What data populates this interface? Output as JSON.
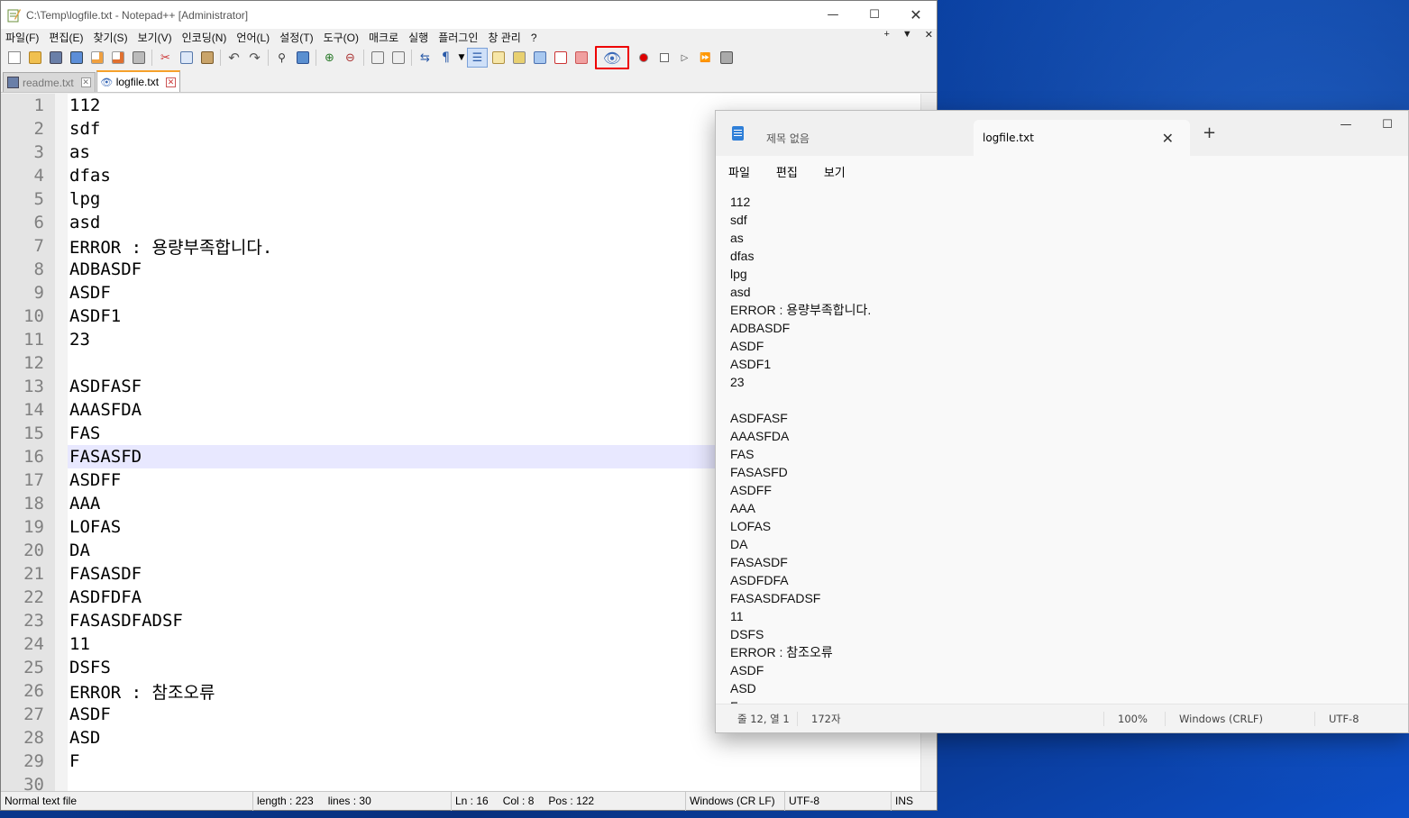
{
  "npp": {
    "title": "C:\\Temp\\logfile.txt - Notepad++ [Administrator]",
    "menu": [
      "파일(F)",
      "편집(E)",
      "찾기(S)",
      "보기(V)",
      "인코딩(N)",
      "언어(L)",
      "설정(T)",
      "도구(O)",
      "매크로",
      "실행",
      "플러그인",
      "창 관리",
      "?"
    ],
    "menu_right": [
      "+",
      "▼",
      "✕"
    ],
    "tabs": [
      {
        "label": "readme.txt",
        "active": false
      },
      {
        "label": "logfile.txt",
        "active": true
      }
    ],
    "lines": [
      "112",
      "sdf",
      "as",
      "dfas",
      "lpg",
      "asd",
      "ERROR : 용량부족합니다.",
      "ADBASDF",
      "ASDF",
      "ASDF1",
      "23",
      "",
      "ASDFASF",
      "AAASFDA",
      "FAS",
      "FASASFD",
      "ASDFF",
      "AAA",
      "LOFAS",
      "DA",
      "FASASDF",
      "ASDFDFA",
      "FASASDFADSF",
      "11",
      "DSFS",
      "ERROR : 참조오류",
      "ASDF",
      "ASD",
      "F",
      ""
    ],
    "current_line": 16,
    "status": {
      "type": "Normal text file",
      "length": "length : 223",
      "lines": "lines : 30",
      "ln": "Ln : 16",
      "col": "Col : 8",
      "pos": "Pos : 122",
      "eol": "Windows (CR LF)",
      "encoding": "UTF-8",
      "mode": "INS"
    }
  },
  "notepad": {
    "tabs": [
      {
        "label": "제목 없음",
        "active": false
      },
      {
        "label": "logfile.txt",
        "active": true
      }
    ],
    "menu": [
      "파일",
      "편집",
      "보기"
    ],
    "lines": [
      "112",
      "sdf",
      "as",
      "dfas",
      "lpg",
      "asd",
      "ERROR : 용량부족합니다.",
      "ADBASDF",
      "ASDF",
      "ASDF1",
      "23",
      "",
      "ASDFASF",
      "AAASFDA",
      "FAS",
      "FASASFD",
      "ASDFF",
      "AAA",
      "LOFAS",
      "DA",
      "FASASDF",
      "ASDFDFA",
      "FASASDFADSF",
      "11",
      "DSFS",
      "ERROR : 참조오류",
      "ASDF",
      "ASD",
      "F"
    ],
    "status": {
      "position": "줄 12, 열 1",
      "chars": "172자",
      "zoom": "100%",
      "eol": "Windows (CRLF)",
      "encoding": "UTF-8"
    }
  },
  "colors": {
    "highlight_box": "#e00000",
    "current_line": "#e8e8ff",
    "tab_accent": "#f6a12b"
  }
}
